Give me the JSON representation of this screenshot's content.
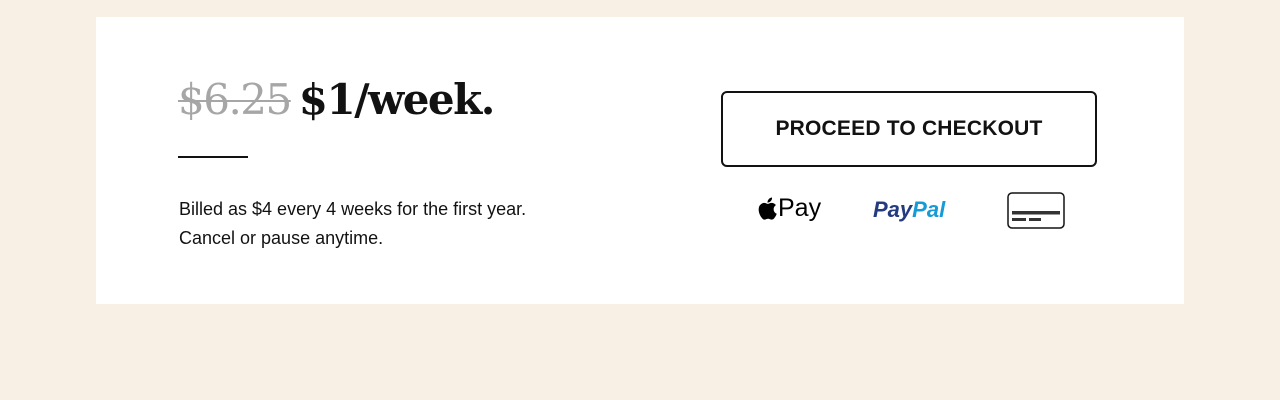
{
  "offer": {
    "old_price": "$6.25",
    "new_price": "$1/week.",
    "billing_line_1": "Billed as $4 every 4 weeks for the first year.",
    "billing_line_2": "Cancel or pause anytime."
  },
  "checkout": {
    "button_label": "PROCEED TO CHECKOUT"
  },
  "payment_methods": {
    "apple_pay_label": "Pay",
    "paypal_part_1": "Pay",
    "paypal_part_2": "Pal",
    "icons": [
      "apple-icon",
      "paypal-logo",
      "credit-card-icon"
    ]
  },
  "colors": {
    "background": "#f8f0e4",
    "card": "#ffffff",
    "text": "#121212",
    "strikethrough": "#a6a6a6",
    "paypal_dark": "#253b80",
    "paypal_light": "#179bd7"
  }
}
